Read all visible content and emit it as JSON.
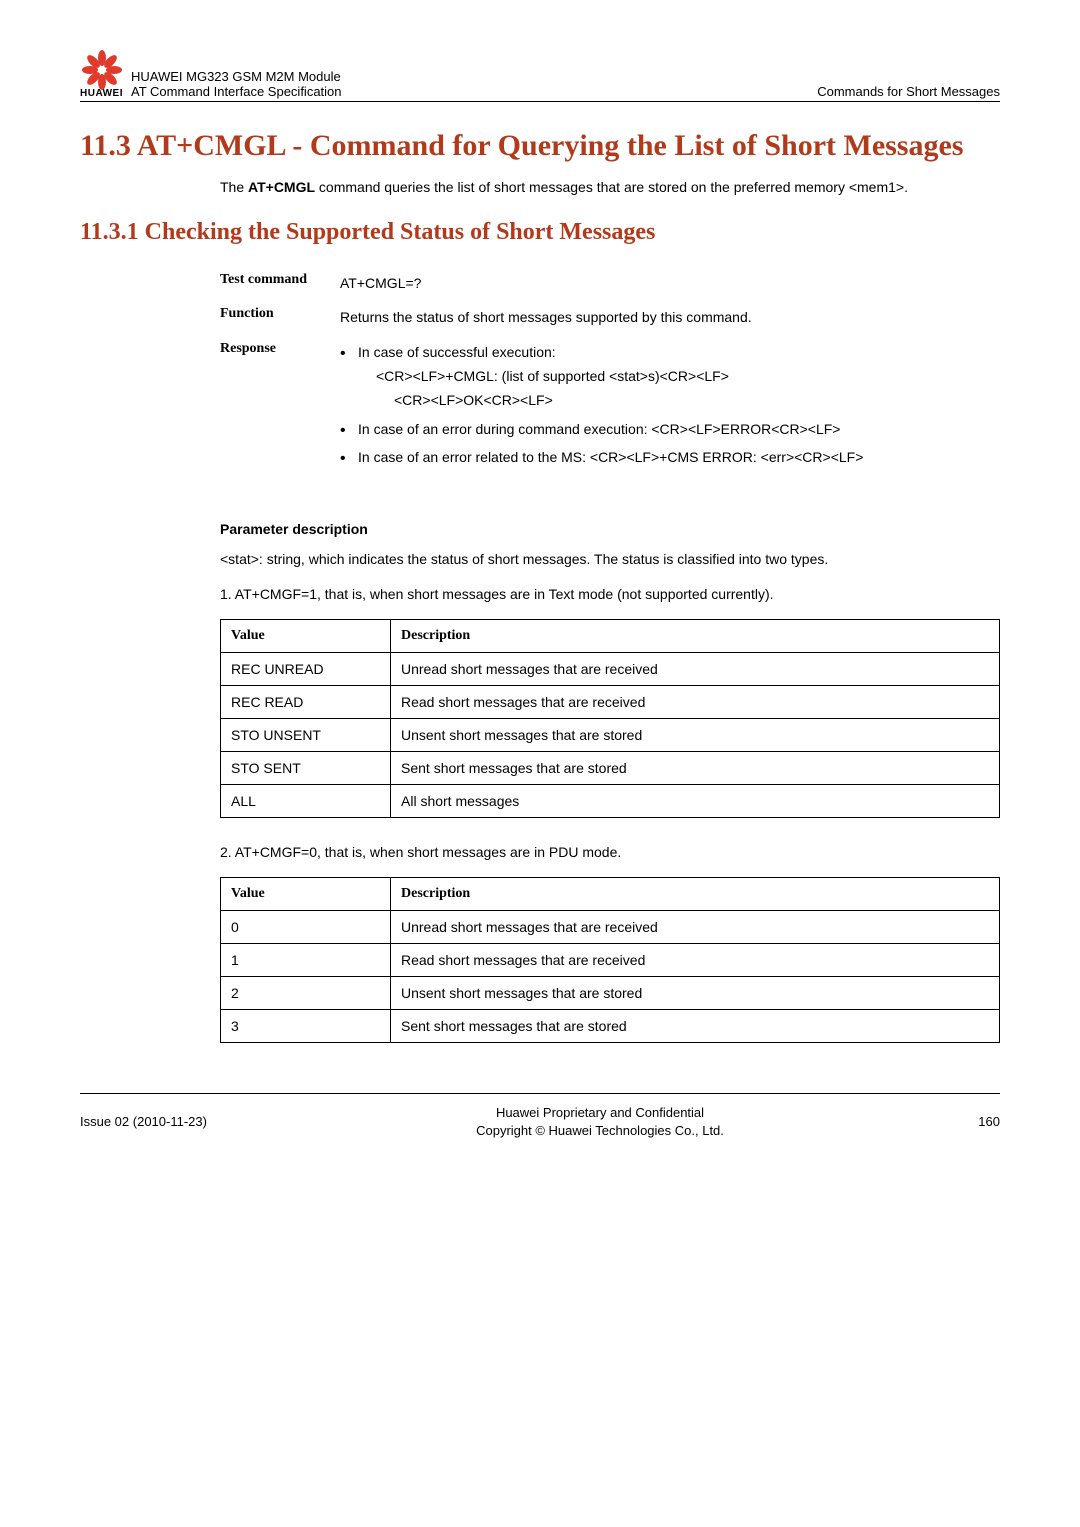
{
  "header": {
    "brand": "HUAWEI",
    "product": "HUAWEI MG323 GSM M2M Module",
    "subtitle": "AT Command Interface Specification",
    "right": "Commands for Short Messages"
  },
  "section": {
    "title": "11.3 AT+CMGL - Command for Querying the List of Short Messages",
    "intro_prefix": "The ",
    "intro_cmd": "AT+CMGL",
    "intro_suffix": " command queries the list of short messages that are stored on the preferred memory <mem1>."
  },
  "subsection": {
    "title": "11.3.1 Checking the Supported Status of Short Messages"
  },
  "cmd": {
    "test_label": "Test command",
    "test_value": "AT+CMGL=?",
    "function_label": "Function",
    "function_value": "Returns the status of short messages supported by this command.",
    "response_label": "Response",
    "response_items": [
      {
        "lead": "In case of successful execution:",
        "lines": [
          "<CR><LF>+CMGL: (list of supported <stat>s)<CR><LF>",
          "<CR><LF>OK<CR><LF>"
        ]
      },
      {
        "lead": "In case of an error during command execution: <CR><LF>ERROR<CR><LF>",
        "lines": []
      },
      {
        "lead": "In case of an error related to the MS: <CR><LF>+CMS ERROR: <err><CR><LF>",
        "lines": []
      }
    ]
  },
  "params": {
    "heading": "Parameter description",
    "stat_text": "<stat>: string, which indicates the status of short messages. The status is classified into two types.",
    "mode1_text": "1.   AT+CMGF=1, that is, when short messages are in Text mode (not supported currently).",
    "mode2_text": "2.   AT+CMGF=0, that is, when short messages are in PDU mode."
  },
  "table_headers": {
    "value": "Value",
    "description": "Description"
  },
  "table1": [
    {
      "value": "REC UNREAD",
      "desc": "Unread short messages that are received"
    },
    {
      "value": "REC READ",
      "desc": "Read short messages that are received"
    },
    {
      "value": "STO UNSENT",
      "desc": "Unsent short messages that are stored"
    },
    {
      "value": "STO SENT",
      "desc": "Sent short messages that are stored"
    },
    {
      "value": "ALL",
      "desc": "All short messages"
    }
  ],
  "table2": [
    {
      "value": "0",
      "desc": "Unread short messages that are received"
    },
    {
      "value": "1",
      "desc": "Read short messages that are received"
    },
    {
      "value": "2",
      "desc": "Unsent short messages that are stored"
    },
    {
      "value": "3",
      "desc": "Sent short messages that are stored"
    }
  ],
  "footer": {
    "left": "Issue 02 (2010-11-23)",
    "center1": "Huawei Proprietary and Confidential",
    "center2": "Copyright © Huawei Technologies Co., Ltd.",
    "right": "160"
  }
}
